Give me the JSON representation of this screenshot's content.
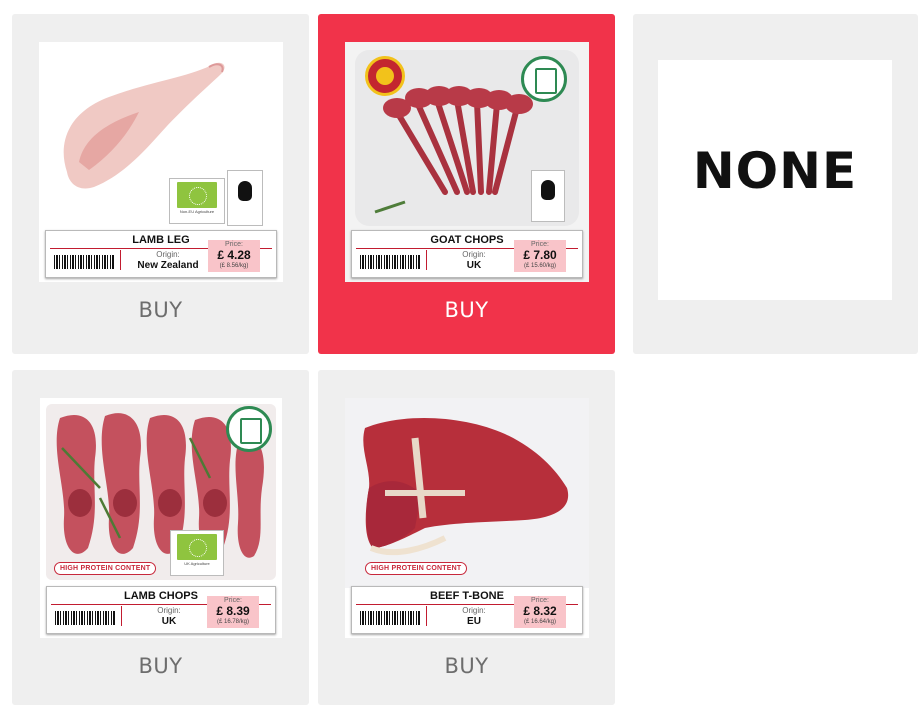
{
  "products": [
    {
      "name": "LAMB LEG",
      "origin_label": "Origin:",
      "origin": "New Zealand",
      "price_label": "Price:",
      "price": "£ 4.28",
      "price_per_kg": "(£ 8.56/kg)",
      "buy_label": "BUY",
      "badges": [
        "eu-organic-leaf",
        "carbon-footprint"
      ],
      "badge_caption": "Non-EU Agriculture",
      "selected": false
    },
    {
      "name": "GOAT CHOPS",
      "origin_label": "Origin:",
      "origin": "UK",
      "price_label": "Price:",
      "price": "£ 7.80",
      "price_per_kg": "(£ 15.60/kg)",
      "buy_label": "BUY",
      "badges": [
        "pdo-seal",
        "welfare-seal",
        "carbon-footprint"
      ],
      "selected": true
    },
    {
      "name": "NONE",
      "selected": false
    },
    {
      "name": "LAMB CHOPS",
      "origin_label": "Origin:",
      "origin": "UK",
      "price_label": "Price:",
      "price": "£ 8.39",
      "price_per_kg": "(£ 16.78/kg)",
      "buy_label": "BUY",
      "badges": [
        "welfare-seal",
        "eu-organic-leaf"
      ],
      "badge_caption": "UK Agriculture",
      "tagline": "HIGH PROTEIN CONTENT",
      "selected": false
    },
    {
      "name": "BEEF T-BONE",
      "origin_label": "Origin:",
      "origin": "EU",
      "price_label": "Price:",
      "price": "£ 8.32",
      "price_per_kg": "(£ 16.64/kg)",
      "buy_label": "BUY",
      "tagline": "HIGH PROTEIN CONTENT",
      "selected": false
    }
  ],
  "colors": {
    "card_bg": "#efefef",
    "selected_bg": "#f1334a",
    "price_bg": "#f9c4c9",
    "accent_red": "#c21c30",
    "organic_green": "#8fc43f"
  }
}
